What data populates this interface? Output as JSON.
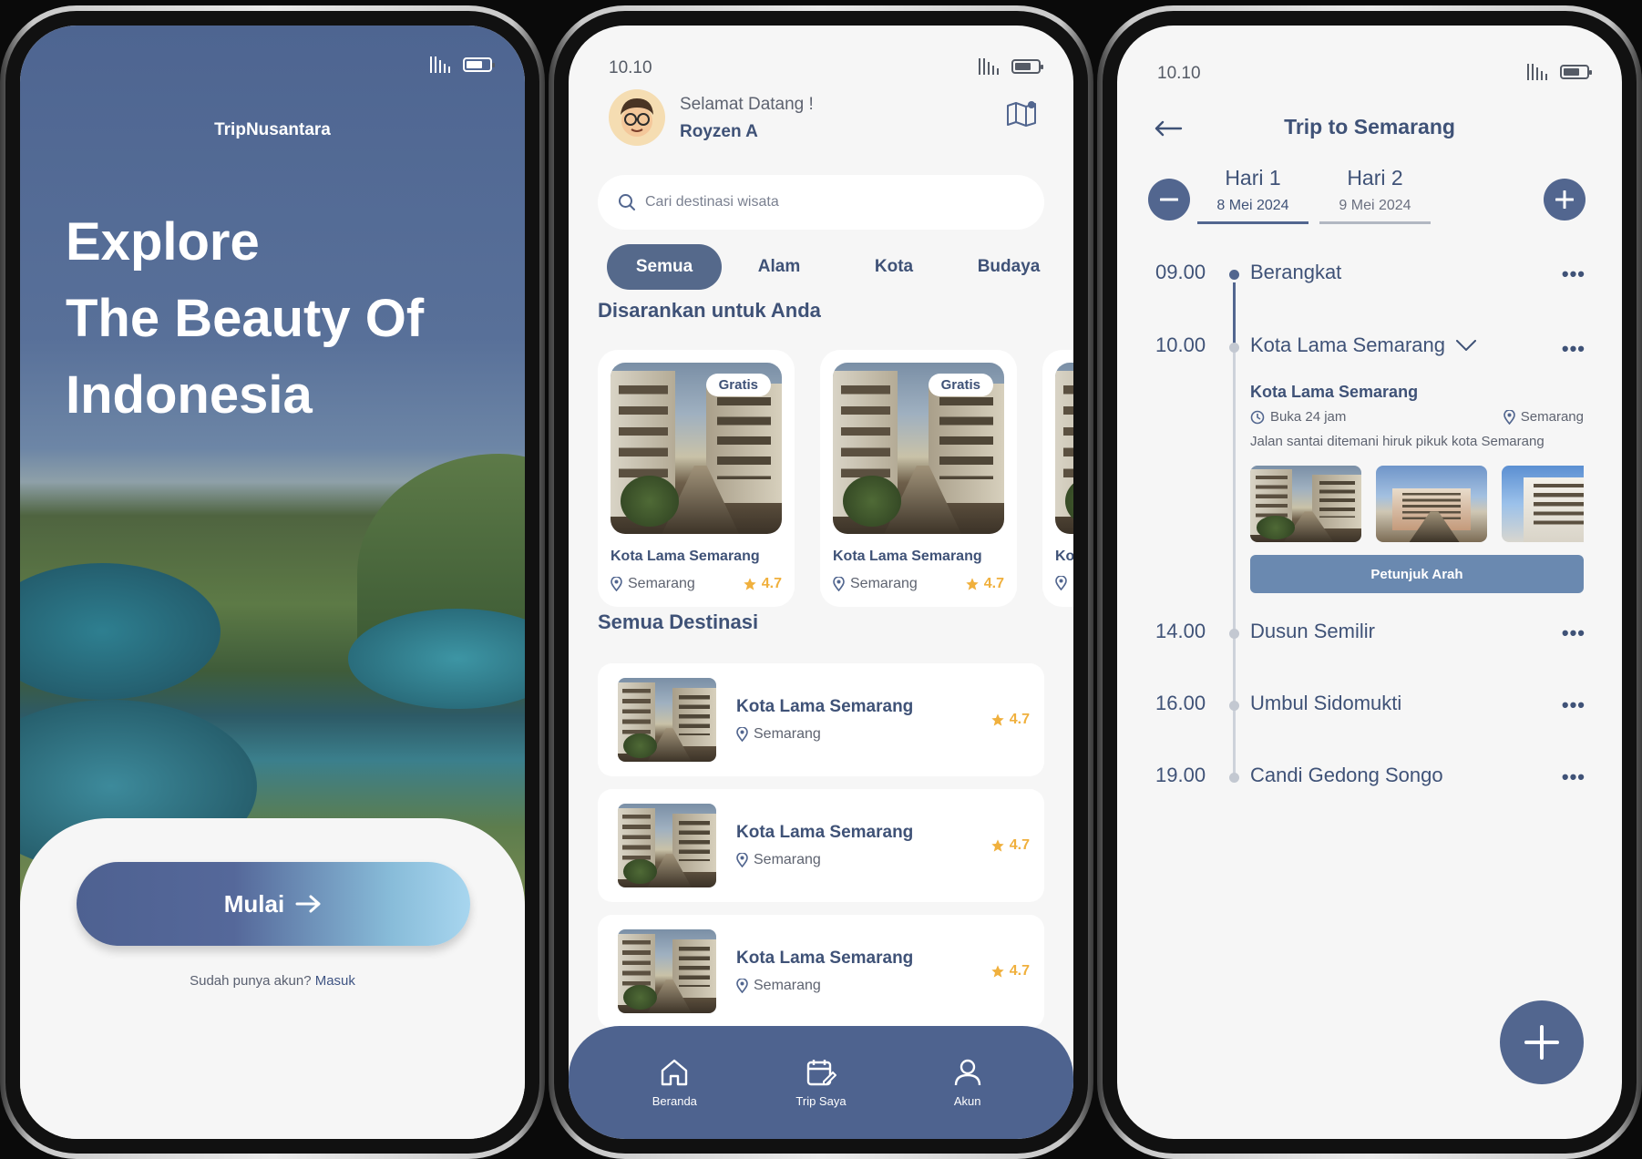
{
  "onboarding": {
    "brand": "TripNusantara",
    "headline": [
      "Explore",
      "The Beauty Of",
      "Indonesia"
    ],
    "start_button": "Mulai",
    "login_prompt": "Sudah punya akun?",
    "login_link": "Masuk"
  },
  "home": {
    "status_time": "10.10",
    "greeting": "Selamat Datang !",
    "user_name": "Royzen A",
    "search_placeholder": "Cari destinasi wisata",
    "tabs": [
      {
        "label": "Semua",
        "active": true
      },
      {
        "label": "Alam",
        "active": false
      },
      {
        "label": "Kota",
        "active": false
      },
      {
        "label": "Budaya",
        "active": false
      }
    ],
    "recommended_title": "Disarankan untuk Anda",
    "recommended": [
      {
        "badge": "Gratis",
        "title": "Kota Lama Semarang",
        "location": "Semarang",
        "rating": "4.7"
      },
      {
        "badge": "Gratis",
        "title": "Kota Lama Semarang",
        "location": "Semarang",
        "rating": "4.7"
      },
      {
        "badge": "",
        "title": "Ko",
        "location": "",
        "rating": ""
      }
    ],
    "all_title": "Semua Destinasi",
    "destinations": [
      {
        "title": "Kota Lama Semarang",
        "location": "Semarang",
        "rating": "4.7"
      },
      {
        "title": "Kota Lama Semarang",
        "location": "Semarang",
        "rating": "4.7"
      },
      {
        "title": "Kota Lama Semarang",
        "location": "Semarang",
        "rating": "4.7"
      }
    ],
    "nav": [
      {
        "label": "Beranda",
        "icon": "home-icon"
      },
      {
        "label": "Trip Saya",
        "icon": "calendar-edit-icon"
      },
      {
        "label": "Akun",
        "icon": "user-icon"
      }
    ]
  },
  "trip": {
    "status_time": "10.10",
    "title": "Trip to Semarang",
    "days": [
      {
        "label": "Hari 1",
        "date": "8 Mei 2024",
        "active": true
      },
      {
        "label": "Hari 2",
        "date": "9 Mei 2024",
        "active": false
      }
    ],
    "schedule": [
      {
        "time": "09.00",
        "place": "Berangkat",
        "active": true
      },
      {
        "time": "10.00",
        "place": "Kota Lama Semarang",
        "active": false,
        "expanded": true
      },
      {
        "time": "14.00",
        "place": "Dusun Semilir",
        "active": false
      },
      {
        "time": "16.00",
        "place": "Umbul Sidomukti",
        "active": false
      },
      {
        "time": "19.00",
        "place": "Candi Gedong Songo",
        "active": false
      }
    ],
    "detail": {
      "title": "Kota Lama Semarang",
      "hours": "Buka 24 jam",
      "location": "Semarang",
      "description": "Jalan santai ditemani hiruk pikuk kota Semarang",
      "direction_button": "Petunjuk Arah"
    },
    "more_label": "•••"
  },
  "colors": {
    "primary": "#52668f",
    "text": "#3f5277",
    "star": "#f0b03d",
    "accent_gradient_end": "#a8d6ef"
  }
}
